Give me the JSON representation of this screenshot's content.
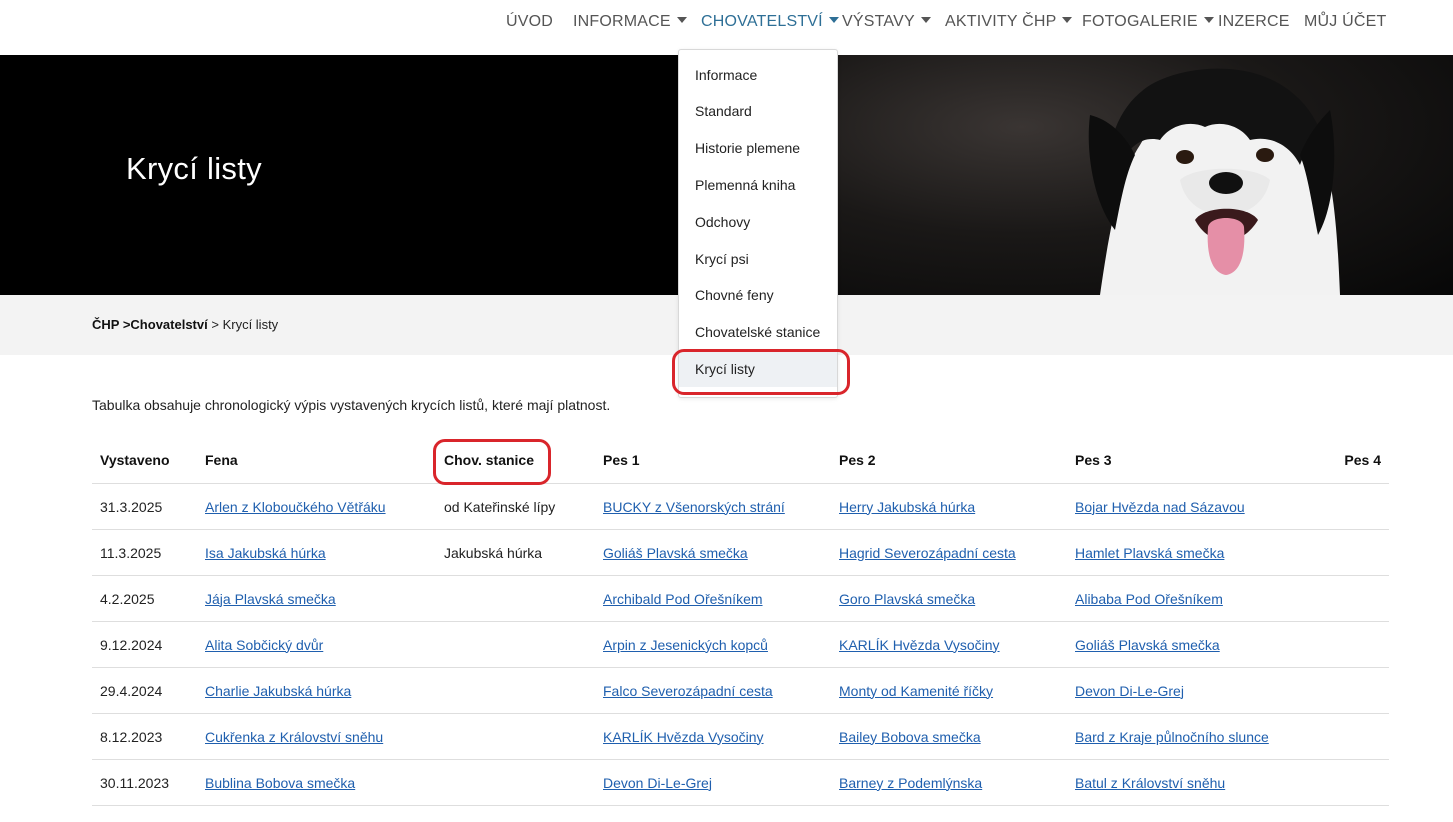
{
  "nav": {
    "items": [
      {
        "label": "ÚVOD",
        "dropdown": false
      },
      {
        "label": "INFORMACE",
        "dropdown": true
      },
      {
        "label": "CHOVATELSTVÍ",
        "dropdown": true,
        "active": true
      },
      {
        "label": "VÝSTAVY",
        "dropdown": true
      },
      {
        "label": "AKTIVITY ČHP",
        "dropdown": true
      },
      {
        "label": "FOTOGALERIE",
        "dropdown": true
      },
      {
        "label": "INZERCE",
        "dropdown": false
      },
      {
        "label": "MŮJ ÚČET",
        "dropdown": false
      }
    ]
  },
  "dropdown": {
    "items": [
      "Informace",
      "Standard",
      "Historie plemene",
      "Plemenná kniha",
      "Odchovy",
      "Krycí psi",
      "Chovné feny",
      "Chovatelské stanice",
      "Krycí listy"
    ],
    "active": "Krycí listy"
  },
  "hero": {
    "title": "Krycí listy"
  },
  "breadcrumb": {
    "root": "ČHP >",
    "section": "Chovatelství",
    "separator": " > ",
    "current": "Krycí listy"
  },
  "intro": "Tabulka obsahuje chronologický výpis vystavených krycích listů, které mají platnost.",
  "table": {
    "headers": [
      "Vystaveno",
      "Fena",
      "Chov. stanice",
      "Pes 1",
      "Pes 2",
      "Pes 3",
      "Pes 4"
    ],
    "rows": [
      [
        "31.3.2025",
        "Arlen z Kloboučkého Větřáku",
        "od Kateřinské lípy",
        "BUCKY z Všenorských strání",
        "Herry Jakubská húrka",
        "Bojar Hvězda nad Sázavou",
        ""
      ],
      [
        "11.3.2025",
        "Isa Jakubská húrka",
        "Jakubská húrka",
        "Goliáš Plavská smečka",
        "Hagrid Severozápadní cesta",
        "Hamlet Plavská smečka",
        ""
      ],
      [
        "4.2.2025",
        "Jája Plavská smečka",
        "",
        "Archibald Pod Ořešníkem",
        "Goro Plavská smečka",
        "Alibaba Pod Ořešníkem",
        ""
      ],
      [
        "9.12.2024",
        "Alita Sobčický dvůr",
        "",
        "Arpin z Jesenických kopců",
        "KARLÍK Hvězda Vysočiny",
        "Goliáš Plavská smečka",
        ""
      ],
      [
        "29.4.2024",
        "Charlie Jakubská húrka",
        "",
        "Falco Severozápadní cesta",
        "Monty od Kamenité říčky",
        "Devon Di-Le-Grej",
        ""
      ],
      [
        "8.12.2023",
        "Cukřenka z Království sněhu",
        "",
        "KARLÍK Hvězda Vysočiny",
        "Bailey Bobova smečka",
        "Bard z Kraje půlnočního slunce",
        ""
      ],
      [
        "30.11.2023",
        "Bublina Bobova smečka",
        "",
        "Devon Di-Le-Grej",
        "Barney z Podemlýnska",
        "Batul z Království sněhu",
        ""
      ]
    ]
  },
  "colors": {
    "accent": "#2e6f96",
    "link": "#1f5fae",
    "annotation": "#d9252b"
  }
}
